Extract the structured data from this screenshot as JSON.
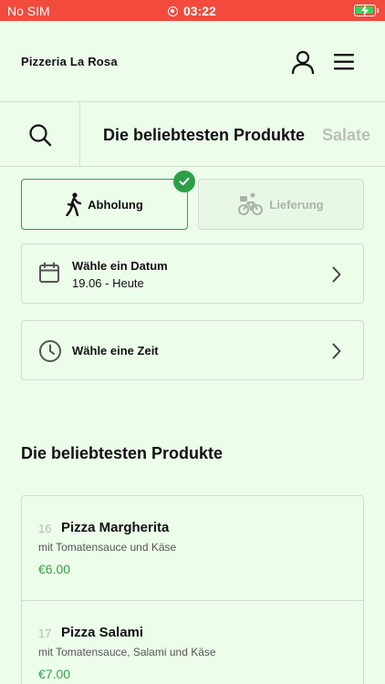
{
  "status_bar": {
    "carrier": "No SIM",
    "time": "03:22",
    "background_color": "#f24a3d",
    "battery_icon": "battery-charging-icon"
  },
  "header": {
    "restaurant_name": "Pizzeria La Rosa",
    "icons": [
      "user-icon",
      "hamburger-menu-icon"
    ]
  },
  "category_bar": {
    "search_icon": "search-icon",
    "tabs": [
      {
        "label": "Die beliebtesten Produkte",
        "active": true
      },
      {
        "label": "Salate",
        "active": false
      }
    ]
  },
  "order_mode": {
    "options": [
      {
        "label": "Abholung",
        "icon": "walking-person-icon",
        "selected": true
      },
      {
        "label": "Lieferung",
        "icon": "bicycle-courier-icon",
        "selected": false
      }
    ],
    "accent_color": "#2e9e46"
  },
  "date_picker": {
    "title": "Wähle ein Datum",
    "value": "19.06 - Heute",
    "icon": "calendar-icon"
  },
  "time_picker": {
    "title": "Wähle eine Zeit",
    "icon": "clock-icon"
  },
  "products": {
    "section_title": "Die beliebtesten Produkte",
    "items": [
      {
        "number": "16",
        "name": "Pizza Margherita",
        "description": "mit Tomatensauce und Käse",
        "price": "€6.00"
      },
      {
        "number": "17",
        "name": "Pizza Salami",
        "description": "mit Tomatensauce, Salami und Käse",
        "price": "€7.00"
      }
    ]
  }
}
